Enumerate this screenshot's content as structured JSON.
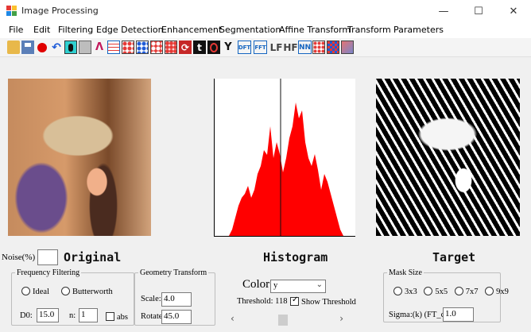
{
  "window": {
    "title": "Image Processing",
    "minimize": "—",
    "maximize": "☐",
    "close": "✕"
  },
  "menu": [
    "File",
    "Edit",
    "Filtering",
    "Edge Detection",
    "Enhancement",
    "Segmentation",
    "Affine Transform",
    "Transform",
    "Parameters"
  ],
  "toolbar": {
    "icons": [
      "open-folder-icon",
      "save-icon",
      "record-icon",
      "undo-icon",
      "invert-icon",
      "gray-square-icon",
      "triangle-icon",
      "grid-lines-icon",
      "dots-icon",
      "dots-blue-icon",
      "dots-red-icon",
      "matrix-icon",
      "rotate-icon",
      "text-t-icon",
      "circle-icon",
      "y-branch-icon",
      "dft-icon",
      "fft-icon",
      "lf-icon",
      "hf-icon",
      "nn-icon",
      "pixel-grid-icon",
      "mosaic-icon",
      "image-icon"
    ],
    "text": {
      "dft": "DFT",
      "fft": "FFT",
      "lf": "LF",
      "hf": "HF",
      "nn": "NN",
      "t": "t"
    }
  },
  "labels": {
    "noise": "Noise(%)",
    "original": "Original",
    "histogram": "Histogram",
    "target": "Target"
  },
  "frequency_filtering": {
    "legend": "Frequency Filtering",
    "ideal": "Ideal",
    "butterworth": "Butterworth",
    "d0_label": "D0:",
    "d0_value": "15.0",
    "n_label": "n:",
    "n_value": "1",
    "abs_label": "abs"
  },
  "geometry_transform": {
    "legend": "Geometry Transform",
    "scale_label": "Scale:",
    "scale_value": "4.0",
    "rotate_label": "Rotate:",
    "rotate_value": "45.0"
  },
  "color": {
    "label": "Color",
    "selected": "y",
    "threshold_text": "Threshold:  118",
    "show_threshold": "Show Threshold",
    "show_threshold_checked": true,
    "slider_left": "‹",
    "slider_right": "›"
  },
  "mask_size": {
    "legend": "Mask Size",
    "options": [
      "3x3",
      "5x5",
      "7x7",
      "9x9"
    ],
    "sigma_label": "Sigma:(k) (FT_c)",
    "sigma_value": "1.0"
  },
  "colors": {
    "histogram": "#ff0000",
    "accent": "#0078d7"
  }
}
